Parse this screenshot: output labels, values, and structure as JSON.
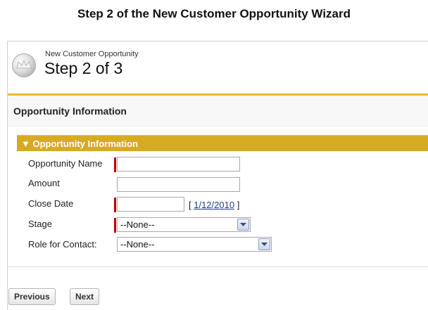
{
  "caption": "Step 2 of the New Customer Opportunity Wizard",
  "header": {
    "subtitle": "New Customer Opportunity",
    "title": "Step 2 of 3",
    "icon": "coin-crown-icon"
  },
  "section": {
    "title": "Opportunity Information"
  },
  "panel": {
    "title": "Opportunity Information",
    "collapse_icon": "triangle-down-icon"
  },
  "form": {
    "opportunity_name": {
      "label": "Opportunity Name",
      "value": ""
    },
    "amount": {
      "label": "Amount",
      "value": ""
    },
    "close_date": {
      "label": "Close Date",
      "value": "",
      "bracket_open": "[ ",
      "today": "1/12/2010",
      "bracket_close": " ]"
    },
    "stage": {
      "label": "Stage",
      "selected": "--None--"
    },
    "role": {
      "label": "Role for Contact:",
      "selected": "--None--"
    }
  },
  "buttons": {
    "previous": "Previous",
    "next": "Next"
  },
  "colors": {
    "accent_gold": "#d7aa24",
    "required_red": "#c00000"
  }
}
